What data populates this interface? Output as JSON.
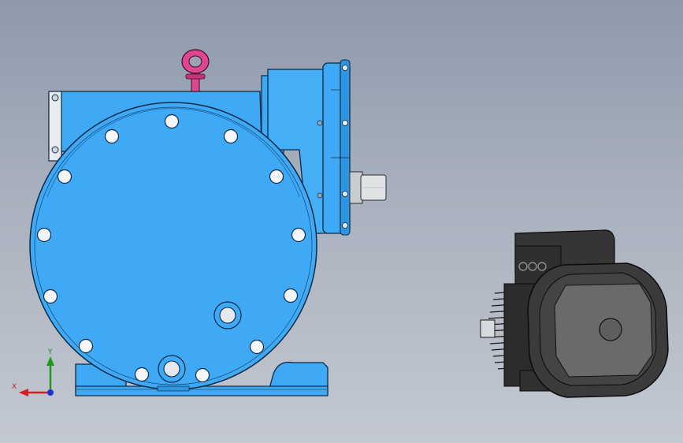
{
  "viewport": {
    "background_top": "#8f99ab",
    "background_bottom": "#c3c8d1"
  },
  "colors": {
    "housing": "#3fa9f5",
    "housing_dark": "#1e78c0",
    "edge": "#0b2a45",
    "lifting_eye": "#e0458f",
    "shaft": "#d9dcdc",
    "motor": "#3b3b3b",
    "motor_light": "#6a6a6a"
  },
  "triad": {
    "x_label": "X",
    "y_label": "Y",
    "x_color": "#d02020",
    "y_color": "#1f9a1f",
    "z_color": "#2030d0"
  },
  "parts": {
    "gearbox": "gearbox-housing",
    "motor": "electric-motor",
    "lifting_eye": "lifting-eye-bolt",
    "output_shaft": "output-shaft"
  }
}
